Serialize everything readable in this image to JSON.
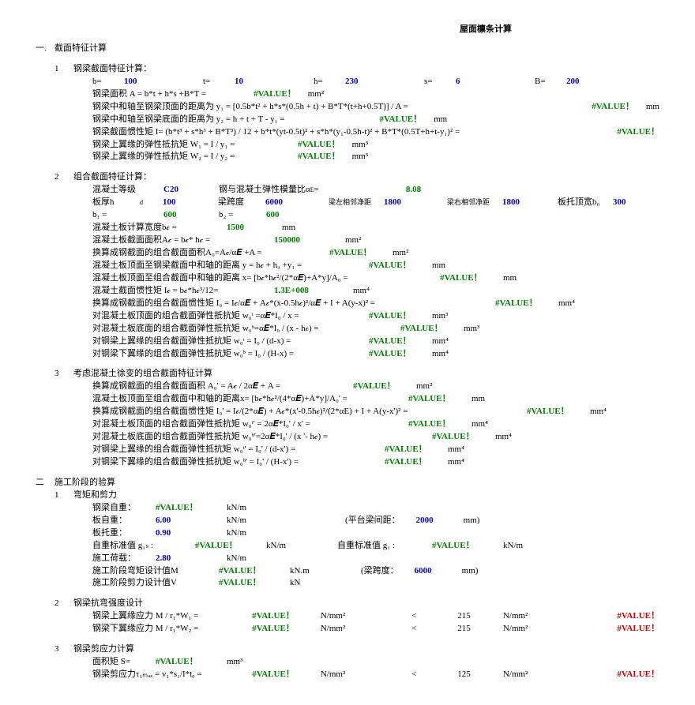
{
  "title": "屋面檩条计算",
  "s1": {
    "h": "一.",
    "t": "截面特征计算"
  },
  "s11": {
    "n": "1",
    "t": "钢梁截面特征计算：",
    "r1": {
      "bL": "b=",
      "b": "100",
      "tL": "t=",
      "t": "10",
      "hL": "h=",
      "h": "230",
      "sL": "s=",
      "s": "6",
      "BL": "B=",
      "B": "200"
    },
    "r2": {
      "l": "钢梁面积  A = b*t + h*s +B*T =",
      "v": "#VALUE！",
      "u": "mm²"
    },
    "r3": {
      "l": "钢梁中和轴至钢梁顶面的距离为 y₁ = [0.5b*t² + h*s*(0.5h + t) + B*T*(t+h+0.5T)] / A =",
      "v": "#VALUE！",
      "u": "mm"
    },
    "r4": {
      "l": "钢梁中和轴至钢梁底面的距离为 y₂ = h + t + T - y₁ =",
      "v": "#VALUE！",
      "u": "mm"
    },
    "r5": {
      "l": "钢梁截面惯性矩 I= (b*t³ + s*h³ + B*T³) / 12 + b*t*(yt-0.5t)² + s*h*(y₁-0.5h-t)² + B*T*(0.5T+h+t-y₁)² =",
      "v": "#VALUE！"
    },
    "r6": {
      "l": "钢梁上翼缘的弹性抵抗矩 W₁ = I / y₁ =",
      "v": "#VALUE！",
      "u": "mm³"
    },
    "r7": {
      "l": "钢梁上翼缘的弹性抵抗矩 W₂ = I / y₂ =",
      "v": "#VALUE！",
      "u": "mm³"
    }
  },
  "s12": {
    "n": "2",
    "t": "组合截面特征计算：",
    "r1": {
      "a": "混凝土等级",
      "av": "C20",
      "b": "钢与混凝土弹性模量比α",
      "bv": "8.08"
    },
    "r2": {
      "a": "板厚h",
      "av": "100",
      "b": "梁跨度",
      "bv": "6000",
      "c": "梁左相邻净距",
      "cv": "1800",
      "d": "梁右相邻净距",
      "dv": "1800",
      "e": "板托顶宽b₀",
      "ev": "300"
    },
    "r3": {
      "a": "b₁ =",
      "av": "600",
      "b": "b₂ =",
      "bv": "600"
    },
    "r4": {
      "l": "混凝土板计算宽度b𝒸 =",
      "v": "1500",
      "u": "mm"
    },
    "r5": {
      "l": "混凝土板截面面积A𝒸 = b𝒸* h𝒸 =",
      "v": "150000",
      "u": "mm²"
    },
    "r6": {
      "l": "换算成钢截面的组合截面面积A₀=A𝒸/α𝑬 +A =",
      "v": "#VALUE！",
      "u": "mm²"
    },
    "r7": {
      "l": "混凝土板顶面至钢梁截面中和轴的距离 y = h𝒸 + h₃ +y₁ =",
      "v": "#VALUE！",
      "u": "mm"
    },
    "r8": {
      "l": "混凝土板顶面至组合截面中和轴的距离 x= [b𝒸*h𝒸²/(2*α𝑬)+A*y]/A₀ =",
      "v": "#VALUE！",
      "u": "mm"
    },
    "r9": {
      "l": "混凝土截面惯性矩 I𝒸 = b𝒸*h𝒸³/12=",
      "v": "1.3E+008",
      "u": "mm⁴"
    },
    "r10": {
      "l": "换算成钢截面的组合截面惯性矩 I₀ = I𝒸/α𝑬 + A𝒸*(x-0.5h𝒸)²/α𝑬 + I + A(y-x)² =",
      "v": "#VALUE！",
      "u": "mm⁴"
    },
    "r11": {
      "l": "对混凝土板顶面的组合截面弹性抵抗矩 w₀ᵗ =α𝑬*I₀ / x =",
      "v": "#VALUE！",
      "u": "mm³"
    },
    "r12": {
      "l": "对混凝土板底面的组合截面弹性抵抗矩 w₀ᵇ=α𝑬*I₀ / (x - h𝒸) =",
      "v": "#VALUE！",
      "u": "mm³"
    },
    "r13": {
      "l": "对钢梁上翼缘的组合截面弹性抵抗矩 w₀ᵗ = I₀ / (d-x) =",
      "v": "#VALUE！",
      "u": "mm⁴"
    },
    "r14": {
      "l": "对钢梁下翼缘的组合截面弹性抵抗矩 w₀ᵇ = I₀ / (H-x) =",
      "v": "#VALUE！",
      "u": "mm⁴"
    }
  },
  "s13": {
    "n": "3",
    "t": "考虑混凝土徐变的组合截面特征计算",
    "r1": {
      "l": "换算成钢截面的组合截面面积 A₀' = A𝒸 / 2α𝑬 + A =",
      "v": "#VALUE！",
      "u": "mm²"
    },
    "r2": {
      "l": "混凝土板顶面至组合截面中和轴的距离x= [b𝒸*h𝒸²/(4*α𝑬)+A*y]/A₀' =",
      "v": "#VALUE！",
      "u": "mm"
    },
    "r3": {
      "l": "换算成钢截面的组合截面惯性矩 I₀' = I𝒸/(2*α𝑬) + A𝒸*(x'-0.5h𝒸)²/(2*αE) + I + A(y-x')² =",
      "v": "#VALUE！",
      "u": "mm⁴"
    },
    "r4": {
      "l": "对混凝土板顶面的组合截面弹性抵抗矩 w₀ᵗ' = 2α𝑬*I₀' / x' =",
      "v": "#VALUE！",
      "u": "mm⁴"
    },
    "r5": {
      "l": "对混凝土板底面的组合截面弹性抵抗矩 w₀ᵇ'=2α𝑬*I₀' / (x '- h𝒸) =",
      "v": "#VALUE！",
      "u": "mm⁴"
    },
    "r6": {
      "l": "对钢梁上翼缘的组合截面弹性抵抗矩 w₀ᵗ' = I₀' / (d-x') =",
      "v": "#VALUE！",
      "u": "mm⁴"
    },
    "r7": {
      "l": "对钢梁下翼缘的组合截面弹性抵抗矩 w₀ᵇ' = I₀' / (H-x') =",
      "v": "#VALUE！",
      "u": "mm⁴"
    }
  },
  "s2": {
    "h": "二",
    "t": "施工阶段的验算"
  },
  "s21": {
    "n": "1",
    "t": "弯矩和剪力",
    "r1": {
      "l": "钢梁自重：",
      "v": "#VALUE！",
      "u": "kN/m"
    },
    "r2": {
      "l": "板自重：",
      "v": "6.00",
      "u": "kN/m",
      "ex": "(平台梁间距：",
      "exv": "2000",
      "exu": "mm)"
    },
    "r3": {
      "l": "板托重：",
      "v": "0.90",
      "u": "kN/m"
    },
    "r4": {
      "l": "自重标准值 g₁ₛ :",
      "v": "#VALUE！",
      "u": "kN/m",
      "ex": "自重标准值 g₁ :",
      "exv": "#VALUE！",
      "exu": "kN/m"
    },
    "r5": {
      "l": "施工荷载：",
      "v": "2.80",
      "u": "kN/m"
    },
    "r6": {
      "l": "施工阶段弯矩设计值M",
      "v": "#VALUE！",
      "u": "kN.m",
      "ex": "(梁跨度：",
      "exv": "6000",
      "exu": "mm)"
    },
    "r7": {
      "l": "施工阶段剪力设计值V",
      "v": "#VALUE！",
      "u": "kN"
    }
  },
  "s22": {
    "n": "2",
    "t": "钢梁抗弯强度设计",
    "r1": {
      "l": "钢梁上翼缘应力 M / r₁*W₁ =",
      "v": "#VALUE！",
      "u": "N/mm²",
      "c": "<",
      "cv": "215",
      "cu": "N/mm²",
      "e": "#VALUE！"
    },
    "r2": {
      "l": "钢梁下翼缘应力 M / r₁*W₂ =",
      "v": "#VALUE！",
      "u": "N/mm²",
      "c": "<",
      "cv": "215",
      "cu": "N/mm²",
      "e": "#VALUE！"
    }
  },
  "s23": {
    "n": "3",
    "t": "钢梁剪应力计算",
    "r1": {
      "l": "面积矩 S=",
      "v": "#VALUE！",
      "u": "mm³"
    },
    "r2": {
      "l": "钢梁剪应力τ₁ₘₐₓ = v₁*s₁/I*tᵨ =",
      "v": "#VALUE！",
      "u": "N/mm²",
      "c": "<",
      "cv": "125",
      "cu": "N/mm²",
      "e": "#VALUE！"
    }
  }
}
